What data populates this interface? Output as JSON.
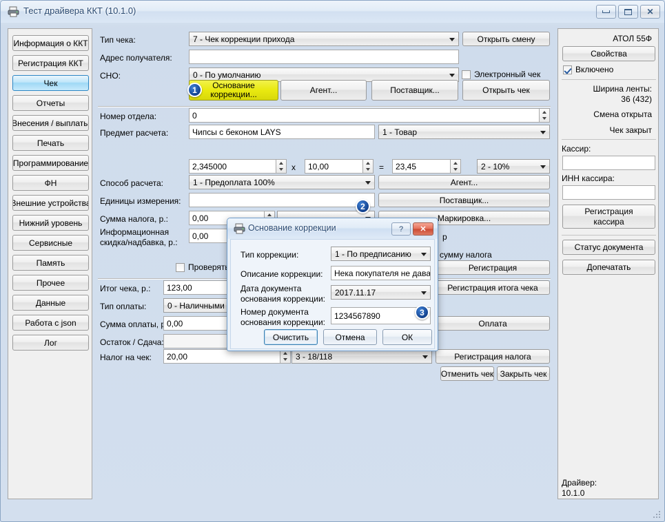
{
  "window": {
    "title": "Тест драйвера ККТ (10.1.0)",
    "icon": "printer-icon",
    "minimize": "–",
    "maximize": "□",
    "close": "✕"
  },
  "sidebar": {
    "items": [
      {
        "label": "Информация о ККТ",
        "active": false
      },
      {
        "label": "Регистрация ККТ",
        "active": false
      },
      {
        "label": "Чек",
        "active": true
      },
      {
        "label": "Отчеты",
        "active": false
      },
      {
        "label": "Внесения / выплаты",
        "active": false
      },
      {
        "label": "Печать",
        "active": false
      },
      {
        "label": "Программирование",
        "active": false
      },
      {
        "label": "ФН",
        "active": false
      },
      {
        "label": "Внешние устройства",
        "active": false
      },
      {
        "label": "Нижний уровень",
        "active": false
      },
      {
        "label": "Сервисные",
        "active": false
      },
      {
        "label": "Память",
        "active": false
      },
      {
        "label": "Прочее",
        "active": false
      },
      {
        "label": "Данные",
        "active": false
      },
      {
        "label": "Работа с json",
        "active": false
      },
      {
        "label": "Лог",
        "active": false
      }
    ]
  },
  "form": {
    "receipt_type_label": "Тип чека:",
    "receipt_type_value": "7 - Чек коррекции прихода",
    "recipient_address_label": "Адрес получателя:",
    "recipient_address_value": "",
    "sno_label": "СНО:",
    "sno_value": "0 - По умолчанию",
    "electronic_receipt_label": "Электронный чек",
    "electronic_receipt_checked": false,
    "open_shift_button": "Открыть смену",
    "open_receipt_button": "Открыть чек",
    "correction_basis_button": "Основание\nкоррекции...",
    "correction_basis_line1": "Основание",
    "correction_basis_line2": "коррекции...",
    "agent_button": "Агент...",
    "supplier_button": "Поставщик...",
    "dept_number_label": "Номер отдела:",
    "dept_number_value": "0",
    "subject_label": "Предмет расчета:",
    "subject_value": "Чипсы с беконом LAYS",
    "subject_type_value": "1 - Товар",
    "quantity_value": "2,345000",
    "multiply_sign": "x",
    "price_value": "10,00",
    "equals_sign": "=",
    "total_value": "23,45",
    "tax_rate_value": "2 - 10%",
    "payment_method_label": "Способ расчета:",
    "payment_method_value": "1 - Предоплата 100%",
    "agent2_button": "Агент...",
    "units_label": "Единицы измерения:",
    "units_value": "",
    "supplier2_button": "Поставщик...",
    "tax_sum_label": "Сумма налога, р.:",
    "tax_sum_value": "0,00",
    "marking_button": "Маркировка...",
    "discount_label_line1": "Информационная",
    "discount_label_line2": "скидка/надбавка, р.:",
    "discount_value": "0,00",
    "hidden_label_r": "р",
    "check_label": "Проверять",
    "check_checked": false,
    "tax_sum_hint": "сумму налога",
    "registration_button": "Регистрация",
    "receipt_total_label": "Итог чека, р.:",
    "receipt_total_value": "123,00",
    "register_total_button": "Регистрация итога чека",
    "payment_type_label": "Тип оплаты:",
    "payment_type_value": "0 - Наличными",
    "payment_sum_label": "Сумма оплаты, р.:",
    "payment_sum_value": "0,00",
    "payment_button": "Оплата",
    "change_label": "Остаток / Сдача:",
    "change_value": "",
    "receipt_tax_label": "Налог на чек:",
    "receipt_tax_value": "20,00",
    "receipt_tax_type_value": "3 - 18/118",
    "register_tax_button": "Регистрация налога",
    "cancel_receipt_button": "Отменить чек",
    "close_receipt_button": "Закрыть чек"
  },
  "right_panel": {
    "device_name": "АТОЛ 55Ф",
    "properties_button": "Свойства",
    "enabled_label": "Включено",
    "enabled_checked": true,
    "tape_width_label": "Ширина ленты:",
    "tape_width_value": "36 (432)",
    "shift_status": "Смена открыта",
    "receipt_status": "Чек закрыт",
    "cashier_label": "Кассир:",
    "cashier_value": "",
    "cashier_inn_label": "ИНН кассира:",
    "cashier_inn_value": "",
    "register_cashier_line1": "Регистрация",
    "register_cashier_line2": "кассира",
    "document_status_button": "Статус документа",
    "reprint_button": "Допечатать",
    "driver_label": "Драйвер:",
    "driver_version": "10.1.0"
  },
  "dialog": {
    "title": "Основание коррекции",
    "icon": "printer-icon",
    "help_button": "?",
    "close_button": "✕",
    "correction_type_label": "Тип коррекции:",
    "correction_type_value": "1 - По предписанию",
    "correction_desc_label": "Описание коррекции:",
    "correction_desc_value": "Нека покупателя не давал. Д",
    "doc_date_label_line1": "Дата документа",
    "doc_date_label_line2": "основания коррекции:",
    "doc_date_value": "2017.11.17",
    "doc_number_label_line1": "Номер документа",
    "doc_number_label_line2": "основания коррекции:",
    "doc_number_value": "1234567890",
    "clear_button": "Очистить",
    "cancel_button": "Отмена",
    "ok_button": "ОК"
  },
  "callouts": [
    {
      "number": "1"
    },
    {
      "number": "2"
    },
    {
      "number": "3"
    }
  ],
  "colors": {
    "accent": "#14438f",
    "highlight_yellow": "#e9e910",
    "selected_blue": "#9ed8f5"
  }
}
